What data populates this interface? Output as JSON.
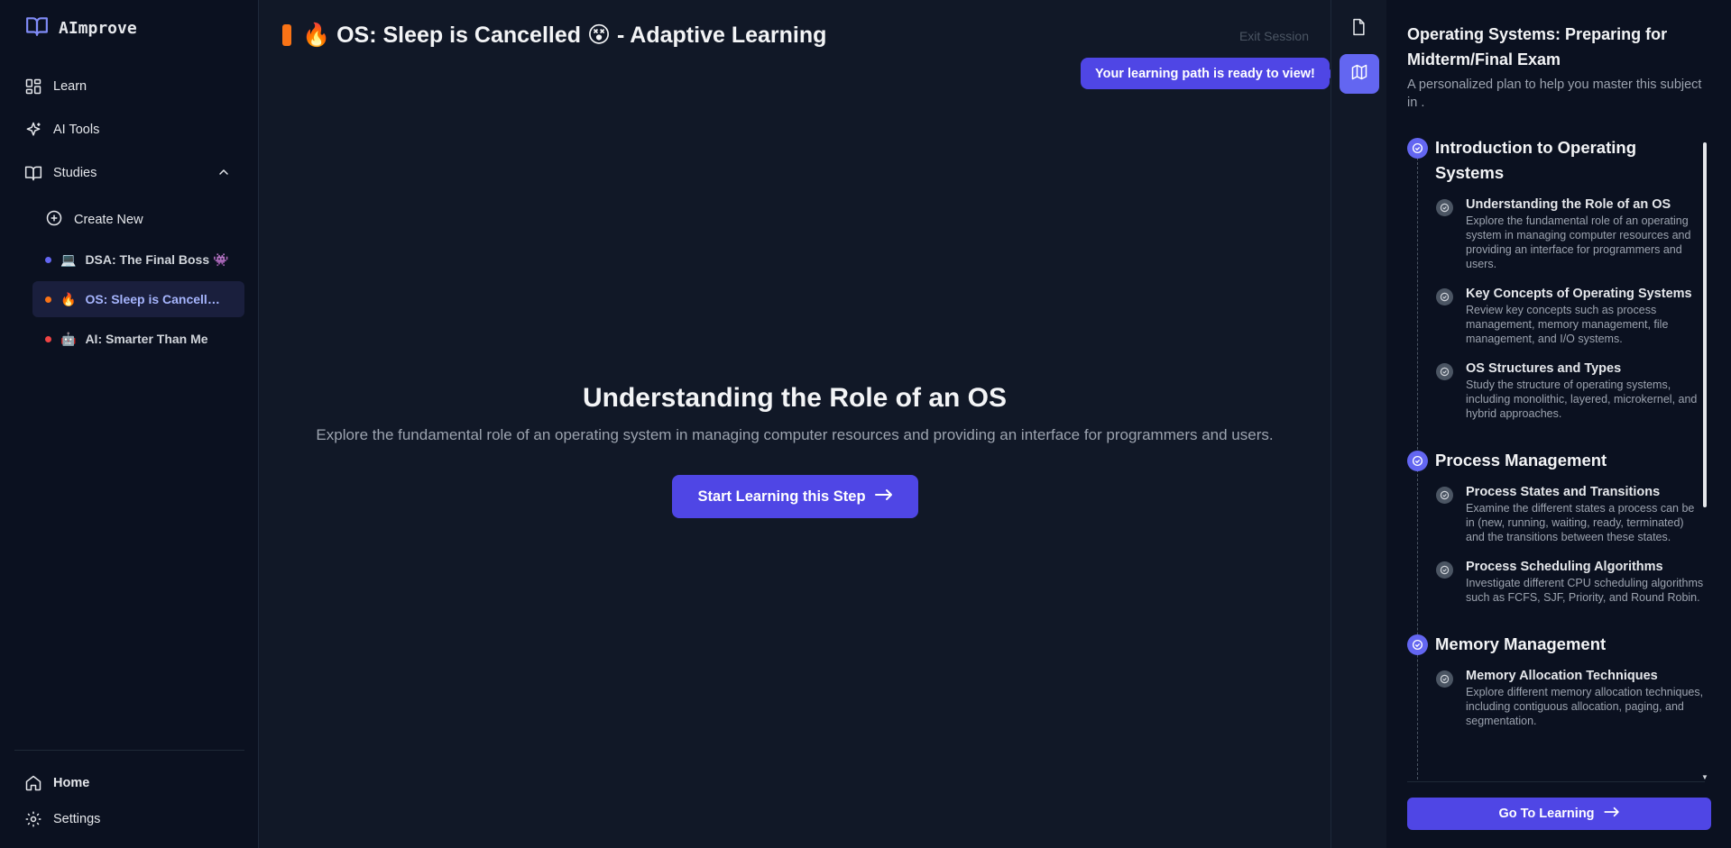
{
  "app": {
    "name": "AImprove"
  },
  "sidebar": {
    "nav": [
      {
        "label": "Learn",
        "icon": "dashboard-icon"
      },
      {
        "label": "AI Tools",
        "icon": "sparkle-icon"
      },
      {
        "label": "Studies",
        "icon": "book-icon",
        "expanded": true
      }
    ],
    "create_new": "Create New",
    "studies": [
      {
        "emoji": "💻",
        "label": "DSA: The Final Boss 👾",
        "dot": "#6366f1",
        "active": false
      },
      {
        "emoji": "🔥",
        "label": "OS: Sleep is Cancelled 😵",
        "dot": "#f97316",
        "active": true
      },
      {
        "emoji": "🤖",
        "label": "AI: Smarter Than Me",
        "dot": "#ef4444",
        "active": false
      }
    ],
    "footer": [
      {
        "label": "Home",
        "icon": "home-icon"
      },
      {
        "label": "Settings",
        "icon": "gear-icon"
      }
    ]
  },
  "main": {
    "title": "🔥 OS: Sleep is Cancelled 😵 - Adaptive Learning",
    "exit": "Exit Session",
    "tooltip": "Your learning path is ready to view!",
    "step_title": "Understanding the Role of an OS",
    "step_desc": "Explore the fundamental role of an operating system in managing computer resources and providing an interface for programmers and users.",
    "start_button": "Start Learning this Step"
  },
  "panel": {
    "title": "Operating Systems: Preparing for Midterm/Final Exam",
    "subtitle": "A personalized plan to help you master this subject in .",
    "sections": [
      {
        "title": "Introduction to Operating Systems",
        "topics": [
          {
            "title": "Understanding the Role of an OS",
            "desc": "Explore the fundamental role of an operating system in managing computer resources and providing an interface for programmers and users."
          },
          {
            "title": "Key Concepts of Operating Systems",
            "desc": "Review key concepts such as process management, memory management, file management, and I/O systems."
          },
          {
            "title": "OS Structures and Types",
            "desc": "Study the structure of operating systems, including monolithic, layered, microkernel, and hybrid approaches."
          }
        ]
      },
      {
        "title": "Process Management",
        "topics": [
          {
            "title": "Process States and Transitions",
            "desc": "Examine the different states a process can be in (new, running, waiting, ready, terminated) and the transitions between these states."
          },
          {
            "title": "Process Scheduling Algorithms",
            "desc": "Investigate different CPU scheduling algorithms such as FCFS, SJF, Priority, and Round Robin."
          }
        ]
      },
      {
        "title": "Memory Management",
        "topics": [
          {
            "title": "Memory Allocation Techniques",
            "desc": "Explore different memory allocation techniques, including contiguous allocation, paging, and segmentation."
          }
        ]
      }
    ],
    "go_button": "Go To Learning"
  },
  "colors": {
    "accent": "#4f46e5",
    "accent_light": "#6366f1",
    "streak": "#f97316"
  }
}
